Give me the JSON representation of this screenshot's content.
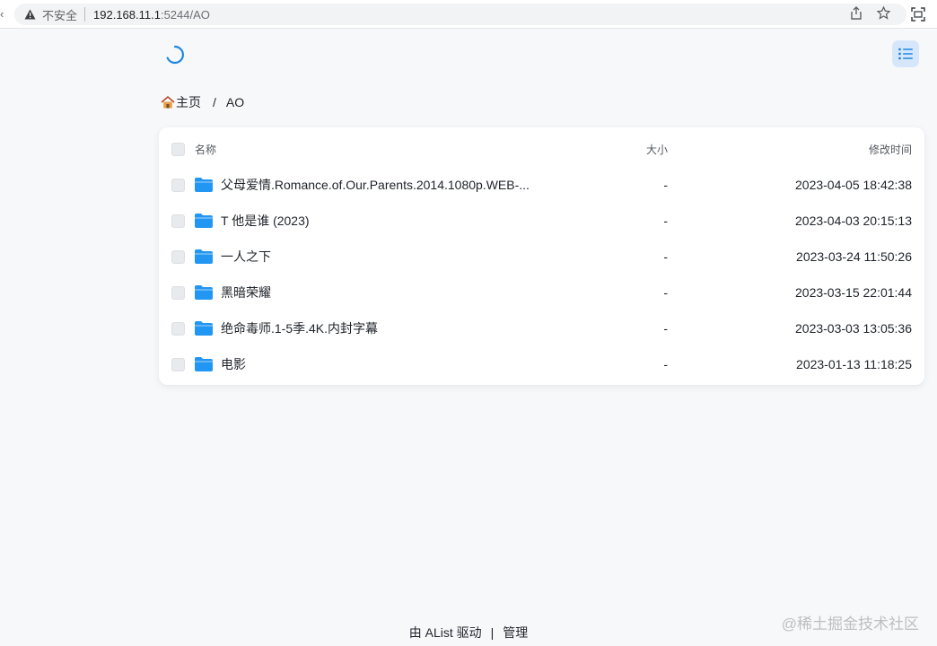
{
  "browser": {
    "security_label": "不安全",
    "host": "192.168.11.1",
    "path": ":5244/AO"
  },
  "breadcrumb": {
    "home": "主页",
    "separator": "/",
    "current": "AO"
  },
  "table": {
    "headers": {
      "name": "名称",
      "size": "大小",
      "modified": "修改时间"
    },
    "rows": [
      {
        "name": "父母爱情.Romance.of.Our.Parents.2014.1080p.WEB-...",
        "size": "-",
        "modified": "2023-04-05 18:42:38"
      },
      {
        "name": "T 他是谁 (2023)",
        "size": "-",
        "modified": "2023-04-03 20:15:13"
      },
      {
        "name": "一人之下",
        "size": "-",
        "modified": "2023-03-24 11:50:26"
      },
      {
        "name": "黑暗荣耀",
        "size": "-",
        "modified": "2023-03-15 22:01:44"
      },
      {
        "name": "绝命毒师.1-5季.4K.内封字幕",
        "size": "-",
        "modified": "2023-03-03 13:05:36"
      },
      {
        "name": "电影",
        "size": "-",
        "modified": "2023-01-13 11:18:25"
      }
    ]
  },
  "footer": {
    "powered_by": "由 AList 驱动",
    "separator": "|",
    "manage": "管理"
  },
  "watermark": "@稀土掘金技术社区",
  "colors": {
    "accent": "#1e88e5",
    "folder": "#2196f3",
    "layout_button_bg": "#d7e7fb"
  },
  "icons": {
    "security": "warning-triangle-icon",
    "share": "share-icon",
    "bookmark": "star-icon",
    "loading": "spinner-icon",
    "layout": "list-view-icon",
    "home": "house-icon",
    "folder": "folder-icon"
  }
}
